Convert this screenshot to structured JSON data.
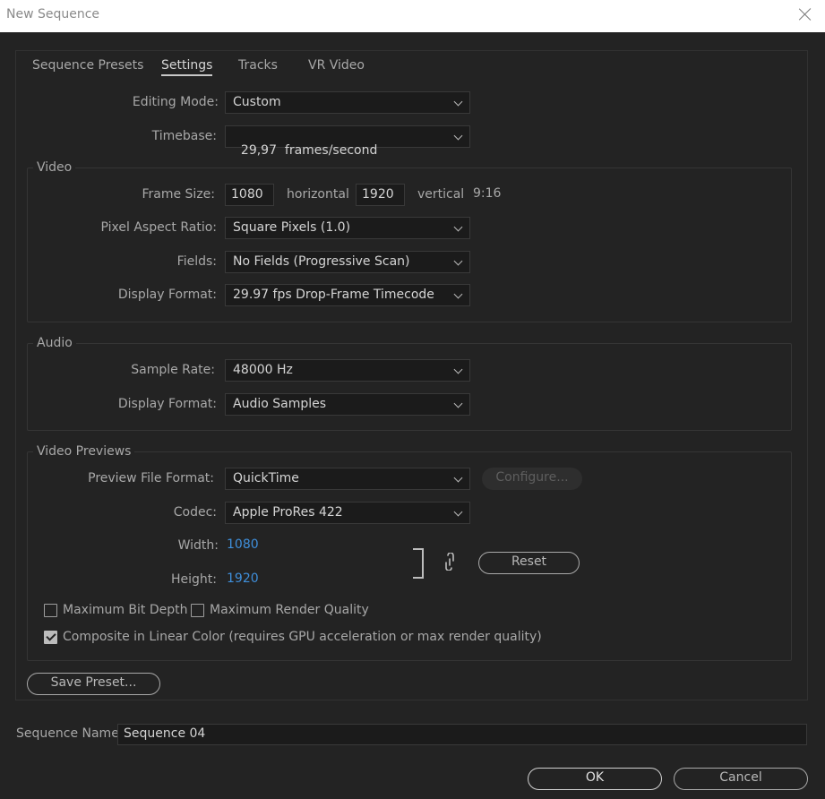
{
  "window": {
    "title": "New Sequence"
  },
  "tabs": [
    {
      "label": "Sequence Presets"
    },
    {
      "label": "Settings"
    },
    {
      "label": "Tracks"
    },
    {
      "label": "VR Video"
    }
  ],
  "editing_mode": {
    "label": "Editing Mode:",
    "value": "Custom"
  },
  "timebase": {
    "label": "Timebase:",
    "value": "29,97  frames/second"
  },
  "video": {
    "title": "Video",
    "frame_size": {
      "label": "Frame Size:",
      "width": "1080",
      "horizontal": "horizontal",
      "height": "1920",
      "vertical": "vertical",
      "ratio": "9:16"
    },
    "pixel_aspect": {
      "label": "Pixel Aspect Ratio:",
      "value": "Square Pixels (1.0)"
    },
    "fields": {
      "label": "Fields:",
      "value": "No Fields (Progressive Scan)"
    },
    "display_format": {
      "label": "Display Format:",
      "value": "29.97 fps Drop-Frame Timecode"
    }
  },
  "audio": {
    "title": "Audio",
    "sample_rate": {
      "label": "Sample Rate:",
      "value": "48000 Hz"
    },
    "display_format": {
      "label": "Display Format:",
      "value": "Audio Samples"
    }
  },
  "previews": {
    "title": "Video Previews",
    "file_format": {
      "label": "Preview File Format:",
      "value": "QuickTime"
    },
    "configure_label": "Configure...",
    "codec": {
      "label": "Codec:",
      "value": "Apple ProRes 422"
    },
    "width": {
      "label": "Width:",
      "value": "1080"
    },
    "height": {
      "label": "Height:",
      "value": "1920"
    },
    "reset_label": "Reset",
    "max_bit_depth": {
      "label": "Maximum Bit Depth",
      "checked": false
    },
    "max_render_quality": {
      "label": "Maximum Render Quality",
      "checked": false
    },
    "linear_color": {
      "label": "Composite in Linear Color (requires GPU acceleration or max render quality)",
      "checked": true
    }
  },
  "save_preset_label": "Save Preset...",
  "sequence_name": {
    "label": "Sequence Name:",
    "value": "Sequence 04"
  },
  "ok_label": "OK",
  "cancel_label": "Cancel",
  "colors": {
    "background": "#232323",
    "field": "#1b1b1b",
    "link_blue": "#3f8fdb",
    "titlebar": "#ffffff"
  },
  "icons": {
    "close": "close-icon",
    "dropdown": "chevron-down-icon",
    "link": "chain-link-icon",
    "check": "checkmark-icon"
  }
}
